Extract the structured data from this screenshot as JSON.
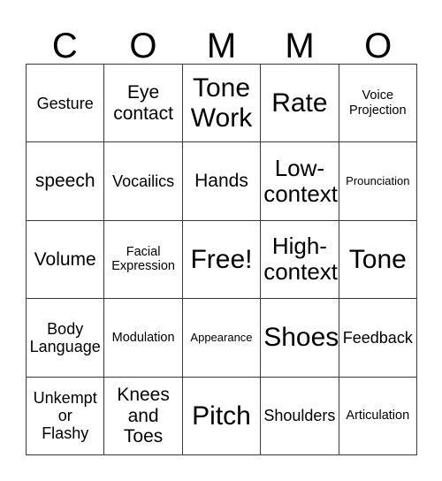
{
  "card": {
    "title_letters": [
      "C",
      "O",
      "M",
      "M",
      "O"
    ],
    "border_color": "#3a3a3a",
    "background_color": "#ffffff",
    "text_color": "#000000",
    "rows": 5,
    "columns": 5
  },
  "cells": [
    {
      "label": "Gesture",
      "size": "sz-m"
    },
    {
      "label": "Eye\ncontact",
      "size": "sz-l"
    },
    {
      "label": "Tone\nWork",
      "size": "sz-xxl"
    },
    {
      "label": "Rate",
      "size": "sz-xxl"
    },
    {
      "label": "Voice\nProjection",
      "size": "sz-s"
    },
    {
      "label": "speech",
      "size": "sz-l"
    },
    {
      "label": "Vocailics",
      "size": "sz-m"
    },
    {
      "label": "Hands",
      "size": "sz-l"
    },
    {
      "label": "Low-\ncontext",
      "size": "sz-xl"
    },
    {
      "label": "Prounciation",
      "size": "sz-xs"
    },
    {
      "label": "Volume",
      "size": "sz-l"
    },
    {
      "label": "Facial\nExpression",
      "size": "sz-s"
    },
    {
      "label": "Free!",
      "size": "sz-xxl"
    },
    {
      "label": "High-\ncontext",
      "size": "sz-xl"
    },
    {
      "label": "Tone",
      "size": "sz-xxl"
    },
    {
      "label": "Body\nLanguage",
      "size": "sz-m"
    },
    {
      "label": "Modulation",
      "size": "sz-s"
    },
    {
      "label": "Appearance",
      "size": "sz-xs"
    },
    {
      "label": "Shoes",
      "size": "sz-xxl"
    },
    {
      "label": "Feedback",
      "size": "sz-m"
    },
    {
      "label": "Unkempt\nor\nFlashy",
      "size": "sz-m"
    },
    {
      "label": "Knees\nand\nToes",
      "size": "sz-l"
    },
    {
      "label": "Pitch",
      "size": "sz-xxl"
    },
    {
      "label": "Shoulders",
      "size": "sz-m"
    },
    {
      "label": "Articulation",
      "size": "sz-s"
    }
  ]
}
